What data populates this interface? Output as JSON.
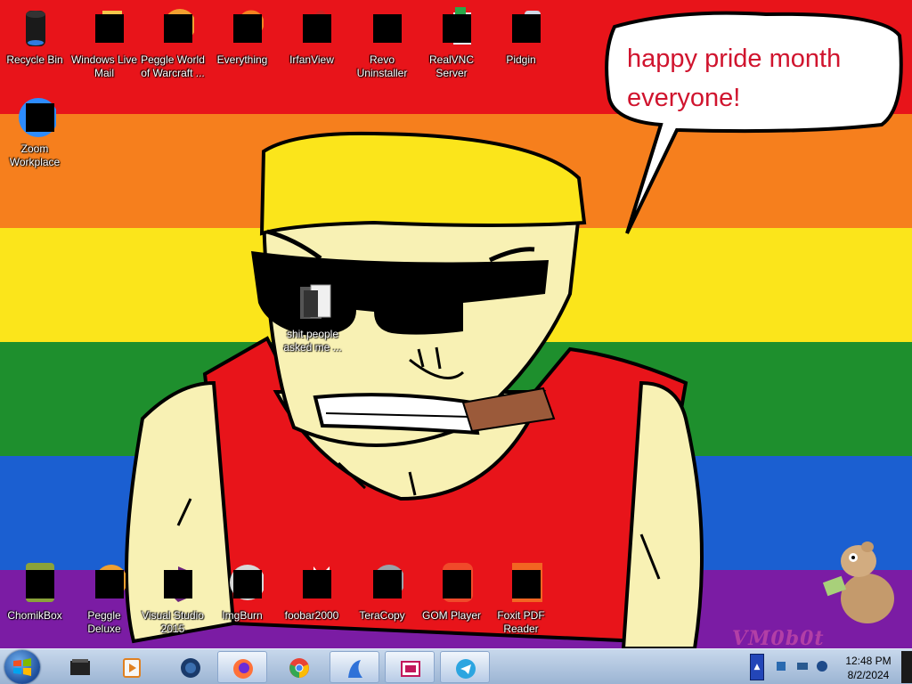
{
  "wallpaper": {
    "speech_bubble": {
      "line1": "happy pride month",
      "line2": "everyone!"
    },
    "watermark": "VM0b0t",
    "stripe_colors": [
      "#e8141a",
      "#f67f1d",
      "#fbe51b",
      "#1e8f2d",
      "#1b5fd1",
      "#7b1ca4"
    ]
  },
  "desktop_icons": {
    "recycle_bin": "Recycle Bin",
    "windows_live_mail": "Windows Live Mail",
    "peggle_world": "Peggle World of Warcraft ...",
    "everything": "Everything",
    "irfanview": "IrfanView",
    "revo": "Revo Uninstaller",
    "realvnc": "RealVNC Server",
    "pidgin": "Pidgin",
    "zoom": "Zoom Workplace",
    "folder": "shit people asked me ...",
    "chomikbox": "ChomikBox",
    "peggle_deluxe": "Peggle Deluxe",
    "visual_studio": "Visual Studio 2015",
    "imgburn": "ImgBurn",
    "foobar": "foobar2000",
    "teracopy": "TeraCopy",
    "gom": "GOM Player",
    "foxit": "Foxit PDF Reader"
  },
  "taskbar": {
    "clock": {
      "time": "12:48 PM",
      "date": "8/2/2024"
    },
    "tray_expand": "▲",
    "pinned_icons": [
      "terminal-icon",
      "media-player-icon",
      "globe-icon",
      "firefox-icon",
      "chrome-icon",
      "launcher-icon",
      "image-viewer-icon",
      "telegram-icon"
    ]
  }
}
